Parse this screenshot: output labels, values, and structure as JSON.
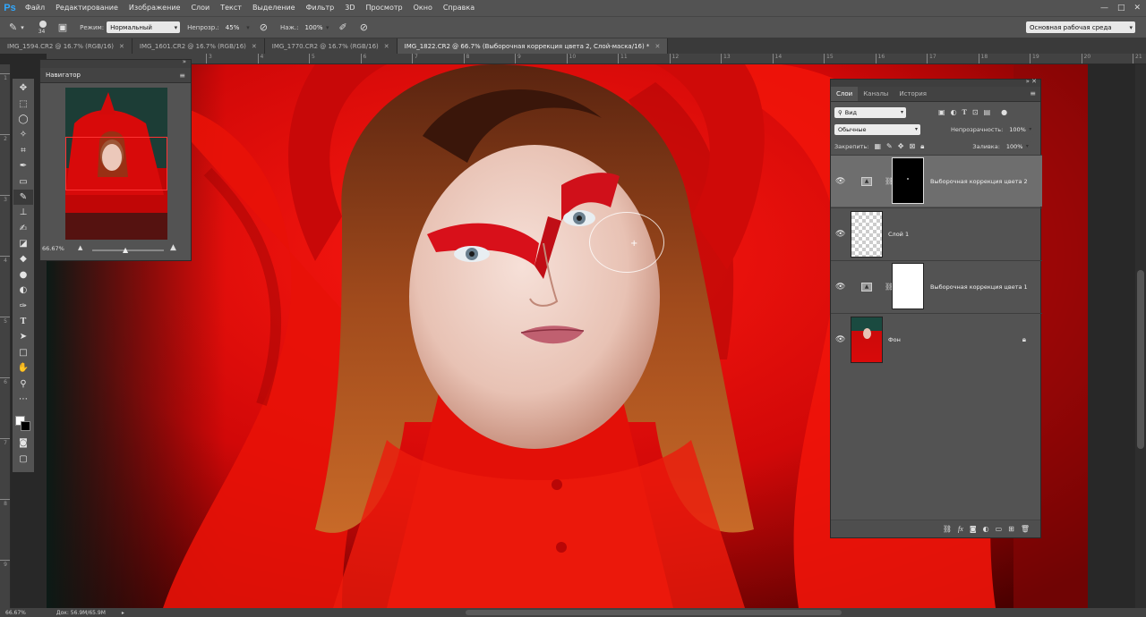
{
  "app": {
    "logo": "Ps",
    "menu": [
      "Файл",
      "Редактирование",
      "Изображение",
      "Слои",
      "Текст",
      "Выделение",
      "Фильтр",
      "3D",
      "Просмотр",
      "Окно",
      "Справка"
    ],
    "window_controls": [
      "—",
      "□",
      "✕"
    ]
  },
  "options": {
    "brush_size": "34",
    "mode_label": "Режим:",
    "mode_value": "Нормальный",
    "opacity_label": "Непрозр.:",
    "opacity_value": "45%",
    "flow_label": "Наж.:",
    "flow_value": "100%",
    "workspace": "Основная рабочая среда"
  },
  "tabs": [
    {
      "label": "IMG_1594.CR2 @ 16.7% (RGB/16)",
      "close": "✕"
    },
    {
      "label": "IMG_1601.CR2 @ 16.7% (RGB/16)",
      "close": "✕"
    },
    {
      "label": "IMG_1770.CR2 @ 16.7% (RGB/16)",
      "close": "✕"
    },
    {
      "label": "IMG_1822.CR2 @ 66.7% (Выборочная коррекция цвета 2, Слой-маска/16) *",
      "close": "✕"
    }
  ],
  "ruler": {
    "h_ticks": [
      "3",
      "4",
      "5",
      "6",
      "7",
      "8",
      "9",
      "10",
      "11",
      "12",
      "13",
      "14",
      "15",
      "16",
      "17",
      "18",
      "19",
      "20",
      "21",
      "22"
    ],
    "v_ticks": [
      "1",
      "2",
      "3",
      "4",
      "5",
      "6",
      "7",
      "8",
      "9"
    ]
  },
  "navigator": {
    "title": "Навигатор",
    "zoom": "66.67%",
    "zoom_level": 0.6
  },
  "layers_panel": {
    "tabs": [
      "Слои",
      "Каналы",
      "История"
    ],
    "filter_label": "Вид",
    "blend_mode": "Обычные",
    "opacity_label": "Непрозрачность:",
    "opacity_value": "100%",
    "lock_label": "Закрепить:",
    "fill_label": "Заливка:",
    "fill_value": "100%",
    "layers": [
      {
        "name": "Выборочная коррекция цвета 2",
        "type": "adjustment",
        "mask": "black",
        "selected": true
      },
      {
        "name": "Слой 1",
        "type": "transparent",
        "selected": false
      },
      {
        "name": "Выборочная коррекция цвета 1",
        "type": "adjustment",
        "mask": "white",
        "selected": false
      },
      {
        "name": "Фон",
        "type": "photo",
        "locked": true,
        "selected": false
      }
    ]
  },
  "status": {
    "zoom": "66.67%",
    "doc": "Док: 56.9M/65.9M"
  },
  "colors": {
    "accent": "#31a8ff",
    "dress_red": "#e40a0a",
    "selection_frame": "#ff3333"
  }
}
